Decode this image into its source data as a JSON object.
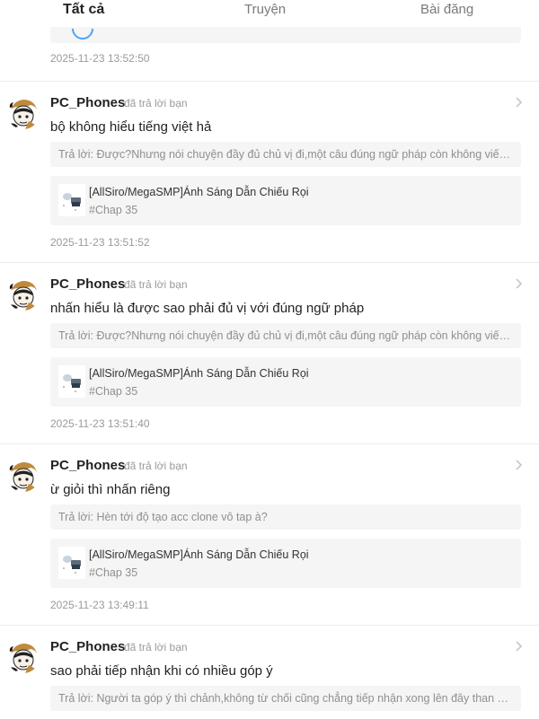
{
  "tabs": [
    {
      "label": "Tất cả",
      "active": true
    },
    {
      "label": "Truyện",
      "active": false
    },
    {
      "label": "Bài đăng",
      "active": false
    }
  ],
  "previous": {
    "time": "2025-11-23 13:52:50"
  },
  "notifications": [
    {
      "user": "PC_Phones",
      "action": "đã trả lời bạn",
      "comment": "bộ không hiểu tiếng việt hả",
      "reply": "Trả lời: Được?Nhưng nói chuyện đầy đủ chủ vị đi,một câu đúng ngữ pháp còn không viết nổi th...",
      "work_title": "[AllSiro/MegaSMP]Ánh Sáng Dẫn Chiếu Rọi",
      "work_chap": "#Chap 35",
      "time": "2025-11-23 13:51:52"
    },
    {
      "user": "PC_Phones",
      "action": "đã trả lời bạn",
      "comment": "nhấn hiểu là được sao phải đủ vị với đúng ngữ pháp",
      "reply": "Trả lời: Được?Nhưng nói chuyện đầy đủ chủ vị đi,một câu đúng ngữ pháp còn không viết nổi th...",
      "work_title": "[AllSiro/MegaSMP]Ánh Sáng Dẫn Chiếu Rọi",
      "work_chap": "#Chap 35",
      "time": "2025-11-23 13:51:40"
    },
    {
      "user": "PC_Phones",
      "action": "đã trả lời bạn",
      "comment": "ừ giỏi thì nhấn riêng",
      "reply": "Trả lời: Hèn tới độ tạo acc clone vô tap à?",
      "work_title": "[AllSiro/MegaSMP]Ánh Sáng Dẫn Chiếu Rọi",
      "work_chap": "#Chap 35",
      "time": "2025-11-23 13:49:11"
    },
    {
      "user": "PC_Phones",
      "action": "đã trả lời bạn",
      "comment": "sao phải tiếp nhận khi có nhiều góp ý",
      "reply": "Trả lời: Người ta góp ý thì chảnh,không từ chối cũng chẳng tiếp nhận xong lên đây than khóc n...",
      "work_title": "",
      "work_chap": "",
      "time": ""
    }
  ]
}
